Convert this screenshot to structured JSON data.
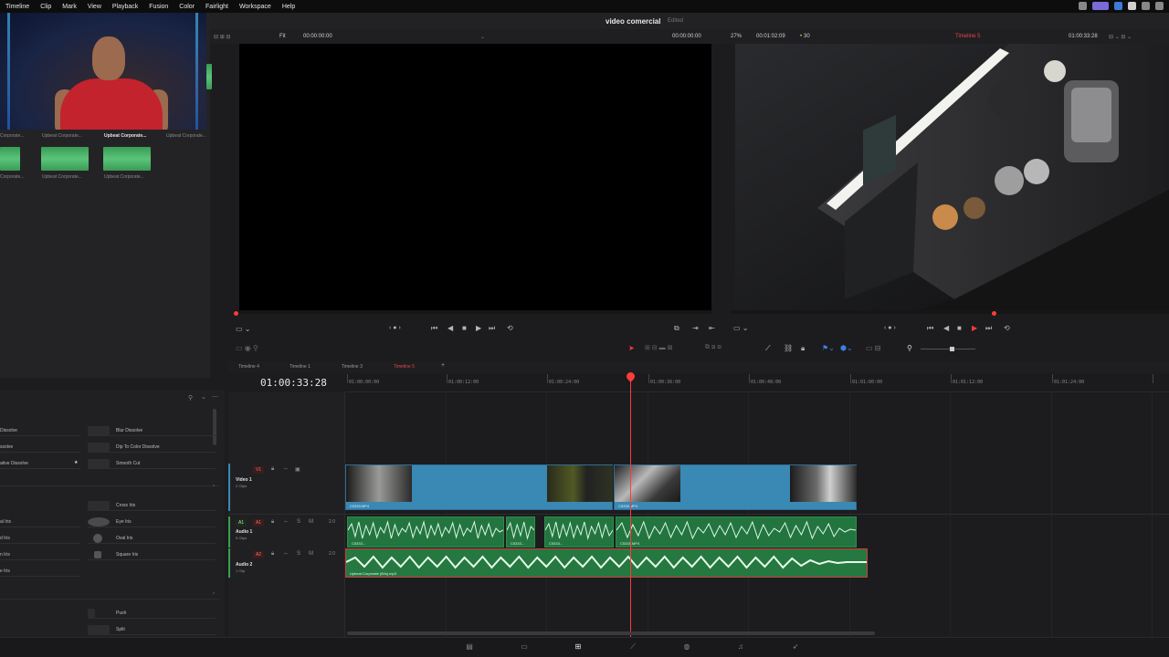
{
  "menu": {
    "items": [
      "Timeline",
      "Clip",
      "Mark",
      "View",
      "Playback",
      "Fusion",
      "Color",
      "Fairlight",
      "Workspace",
      "Help"
    ]
  },
  "project": {
    "name": "video comercial",
    "status": "Edited"
  },
  "source_viewer": {
    "zoom": "Fit",
    "timecode_left": "00:00:00:00",
    "timecode_right": "00:00:00:00"
  },
  "timeline_viewer": {
    "zoom": "27%",
    "duration": "00:01:02:09",
    "fps": "30",
    "timeline_name": "Timeline 5",
    "timecode": "01:00:33:28"
  },
  "media_pool": {
    "clips_row1": [
      "Corporate...",
      "Upbeat Corporate...",
      "Upbeat Corporate...",
      "Upbeat Corporate..."
    ],
    "clips_row2": [
      "Corporate...",
      "Upbeat Corporate...",
      "Upbeat Corporate..."
    ]
  },
  "timeline_tabs": [
    "Timeline 4",
    "Timeline 1",
    "Timeline 3",
    "Timeline 5"
  ],
  "timeline": {
    "current_timecode": "01:00:33:28",
    "ruler": [
      "01:00:00:00",
      "01:00:12:00",
      "01:00:24:00",
      "01:00:36:00",
      "01:00:48:00",
      "01:01:00:00",
      "01:01:12:00",
      "01:01:24:00"
    ],
    "tracks": {
      "v1": {
        "tag": "V1",
        "name": "Video 1",
        "sub": "2 Clips"
      },
      "a1": {
        "tag": "A1",
        "name": "Audio 1",
        "sub": "5 Clips",
        "level": "2.0"
      },
      "a2": {
        "tag": "A2",
        "name": "Audio 2",
        "sub": "1 Clip",
        "level": "2.0"
      }
    },
    "clips": {
      "v1_clip1": "C5333.MP4",
      "v1_clip2": "C5335.MP4",
      "a1_clip1": "C5333...",
      "a1_clip2": "C5333...",
      "a1_clip3": "C5333...",
      "a1_clip4": "C5335.MP4",
      "a2_clip": "Upbeat Corporate (60s).mp3"
    }
  },
  "effects": {
    "left_items": [
      "Dissolve",
      "ssolve",
      "ative Dissolve",
      "al Iris",
      "d Iris",
      "n Iris",
      "e Iris"
    ],
    "right_items": [
      "Blur Dissolve",
      "Dip To Color Dissolve",
      "Smooth Cut",
      "Cross Iris",
      "Eye Iris",
      "Oval Iris",
      "Square Iris",
      "Push",
      "Split"
    ]
  },
  "colors": {
    "accent_red": "#ff3b3b",
    "video_clip": "#3a88b4",
    "audio_clip": "#23753f"
  }
}
